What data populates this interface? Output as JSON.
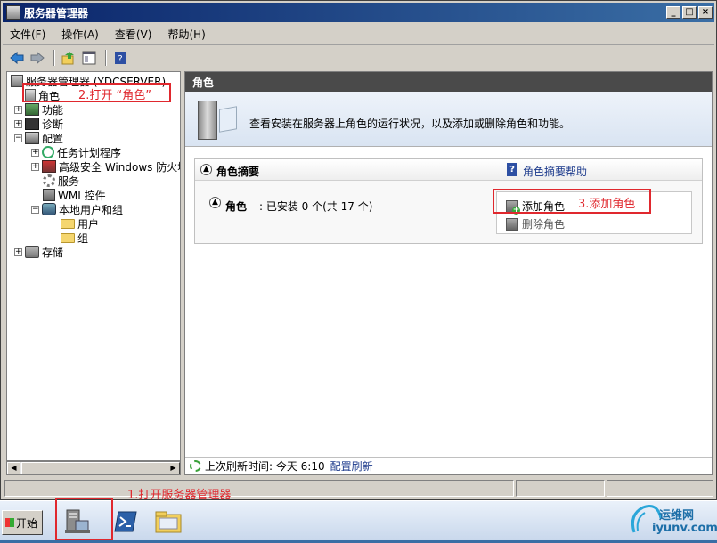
{
  "window": {
    "title": "服务器管理器",
    "controls": [
      "_",
      "□",
      "×"
    ]
  },
  "menubar": {
    "items": [
      "文件(F)",
      "操作(A)",
      "查看(V)",
      "帮助(H)"
    ]
  },
  "toolbar": {
    "buttons": [
      "back-icon",
      "forward-icon",
      "up-icon",
      "show-hide-tree-icon",
      "help-icon"
    ]
  },
  "tree": {
    "root": "服务器管理器 (YDCSERVER)",
    "roles": "角色",
    "features": "功能",
    "diagnostics": "诊断",
    "configuration": "配置",
    "task_scheduler": "任务计划程序",
    "firewall": "高级安全 Windows 防火墙",
    "services": "服务",
    "wmi": "WMI 控件",
    "local_users": "本地用户和组",
    "users": "用户",
    "groups": "组",
    "storage": "存储"
  },
  "main": {
    "header": "角色",
    "intro": "查看安装在服务器上角色的运行状况，以及添加或删除角色和功能。",
    "summary_title": "角色摘要",
    "summary_help": "角色摘要帮助",
    "roles_label": "角色",
    "roles_status": ": 已安装 0 个(共 17 个)",
    "add_roles": "添加角色",
    "remove_roles": "删除角色",
    "refresh_text": "上次刷新时间: 今天 6:10",
    "refresh_link": "配置刷新"
  },
  "annotations": {
    "step1": "1.打开服务器管理器",
    "step2": "2.打开 “角色”",
    "step3": "3.添加角色"
  },
  "taskbar": {
    "start": "开始"
  },
  "watermark": {
    "name": "运维网",
    "url": "iyunv.com"
  },
  "colors": {
    "annotation": "#e0282e",
    "title_bar": "#0a246a",
    "link": "#1c3a8c",
    "panel_header": "#4a4a4a"
  }
}
